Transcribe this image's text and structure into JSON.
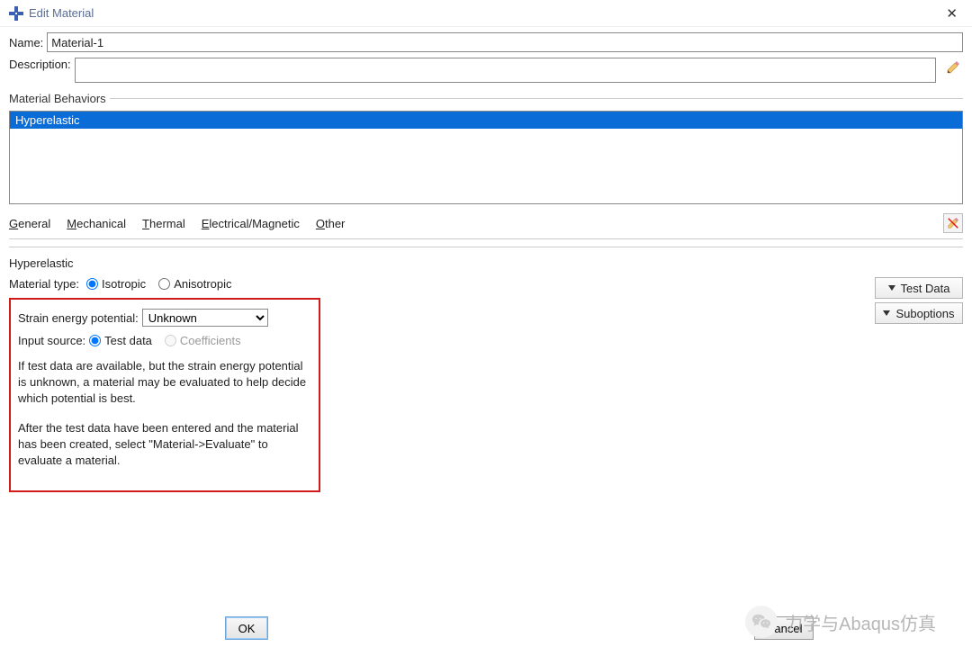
{
  "titlebar": {
    "title": "Edit Material"
  },
  "fields": {
    "name_label": "Name:",
    "name_value": "Material-1",
    "description_label": "Description:",
    "description_value": ""
  },
  "behaviors": {
    "legend": "Material Behaviors",
    "items": [
      "Hyperelastic"
    ],
    "selected_index": 0
  },
  "menu": {
    "general": "General",
    "mechanical": "Mechanical",
    "thermal": "Thermal",
    "electrical": "Electrical/Magnetic",
    "other": "Other"
  },
  "section": {
    "title": "Hyperelastic",
    "material_type_label": "Material type:",
    "radio_isotropic": "Isotropic",
    "radio_anisotropic": "Anisotropic",
    "test_data_btn": "Test Data",
    "suboptions_btn": "Suboptions",
    "strain_label": "Strain energy potential:",
    "strain_value": "Unknown",
    "input_source_label": "Input source:",
    "radio_test_data": "Test data",
    "radio_coefficients": "Coefficients",
    "help_para1": "If test data are available, but the strain energy potential is unknown, a material may be evaluated to help decide which potential is best.",
    "help_para2": "After the test data have been entered and the material has been created, select \"Material->Evaluate\" to evaluate a material."
  },
  "buttons": {
    "ok": "OK",
    "cancel": "Cancel"
  },
  "watermark": {
    "text": "力学与Abaqus仿真"
  }
}
